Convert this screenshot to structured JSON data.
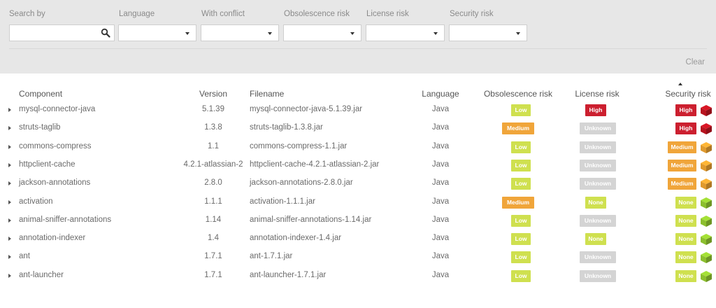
{
  "filters": {
    "search_by_label": "Search by",
    "language_label": "Language",
    "with_conflict_label": "With conflict",
    "obsolescence_label": "Obsolescence risk",
    "license_label": "License risk",
    "security_label": "Security risk",
    "clear_label": "Clear"
  },
  "table": {
    "headers": {
      "component": "Component",
      "version": "Version",
      "filename": "Filename",
      "language": "Language",
      "obsolescence": "Obsolescence risk",
      "license": "License risk",
      "security": "Security risk"
    },
    "rows": [
      {
        "component": "mysql-connector-java",
        "version": "5.1.39",
        "filename": "mysql-connector-java-5.1.39.jar",
        "language": "Java",
        "obsolescence": "Low",
        "license": "High",
        "security": "High"
      },
      {
        "component": "struts-taglib",
        "version": "1.3.8",
        "filename": "struts-taglib-1.3.8.jar",
        "language": "Java",
        "obsolescence": "Medium",
        "license": "Unknown",
        "security": "High"
      },
      {
        "component": "commons-compress",
        "version": "1.1",
        "filename": "commons-compress-1.1.jar",
        "language": "Java",
        "obsolescence": "Low",
        "license": "Unknown",
        "security": "Medium"
      },
      {
        "component": "httpclient-cache",
        "version": "4.2.1-atlassian-2",
        "filename": "httpclient-cache-4.2.1-atlassian-2.jar",
        "language": "Java",
        "obsolescence": "Low",
        "license": "Unknown",
        "security": "Medium"
      },
      {
        "component": "jackson-annotations",
        "version": "2.8.0",
        "filename": "jackson-annotations-2.8.0.jar",
        "language": "Java",
        "obsolescence": "Low",
        "license": "Unknown",
        "security": "Medium"
      },
      {
        "component": "activation",
        "version": "1.1.1",
        "filename": "activation-1.1.1.jar",
        "language": "Java",
        "obsolescence": "Medium",
        "license": "None",
        "security": "None"
      },
      {
        "component": "animal-sniffer-annotations",
        "version": "1.14",
        "filename": "animal-sniffer-annotations-1.14.jar",
        "language": "Java",
        "obsolescence": "Low",
        "license": "Unknown",
        "security": "None"
      },
      {
        "component": "annotation-indexer",
        "version": "1.4",
        "filename": "annotation-indexer-1.4.jar",
        "language": "Java",
        "obsolescence": "Low",
        "license": "None",
        "security": "None"
      },
      {
        "component": "ant",
        "version": "1.7.1",
        "filename": "ant-1.7.1.jar",
        "language": "Java",
        "obsolescence": "Low",
        "license": "Unknown",
        "security": "None"
      },
      {
        "component": "ant-launcher",
        "version": "1.7.1",
        "filename": "ant-launcher-1.7.1.jar",
        "language": "Java",
        "obsolescence": "Low",
        "license": "Unknown",
        "security": "None"
      }
    ]
  },
  "colors": {
    "High": "#cc1f2f",
    "Medium": "#f0a53a",
    "Low": "#cfe04f",
    "None": "#cfe04f",
    "Unknown": "#d4d4d4",
    "cube_High": "#b8131f",
    "cube_Medium": "#e09a2e",
    "cube_None": "#8cbf2e"
  },
  "icons": {
    "search": "search-icon",
    "dropdown": "chevron-down-icon",
    "sort": "sort-ascending-icon",
    "expand": "expand-arrow-icon",
    "security": "cube-icon"
  }
}
